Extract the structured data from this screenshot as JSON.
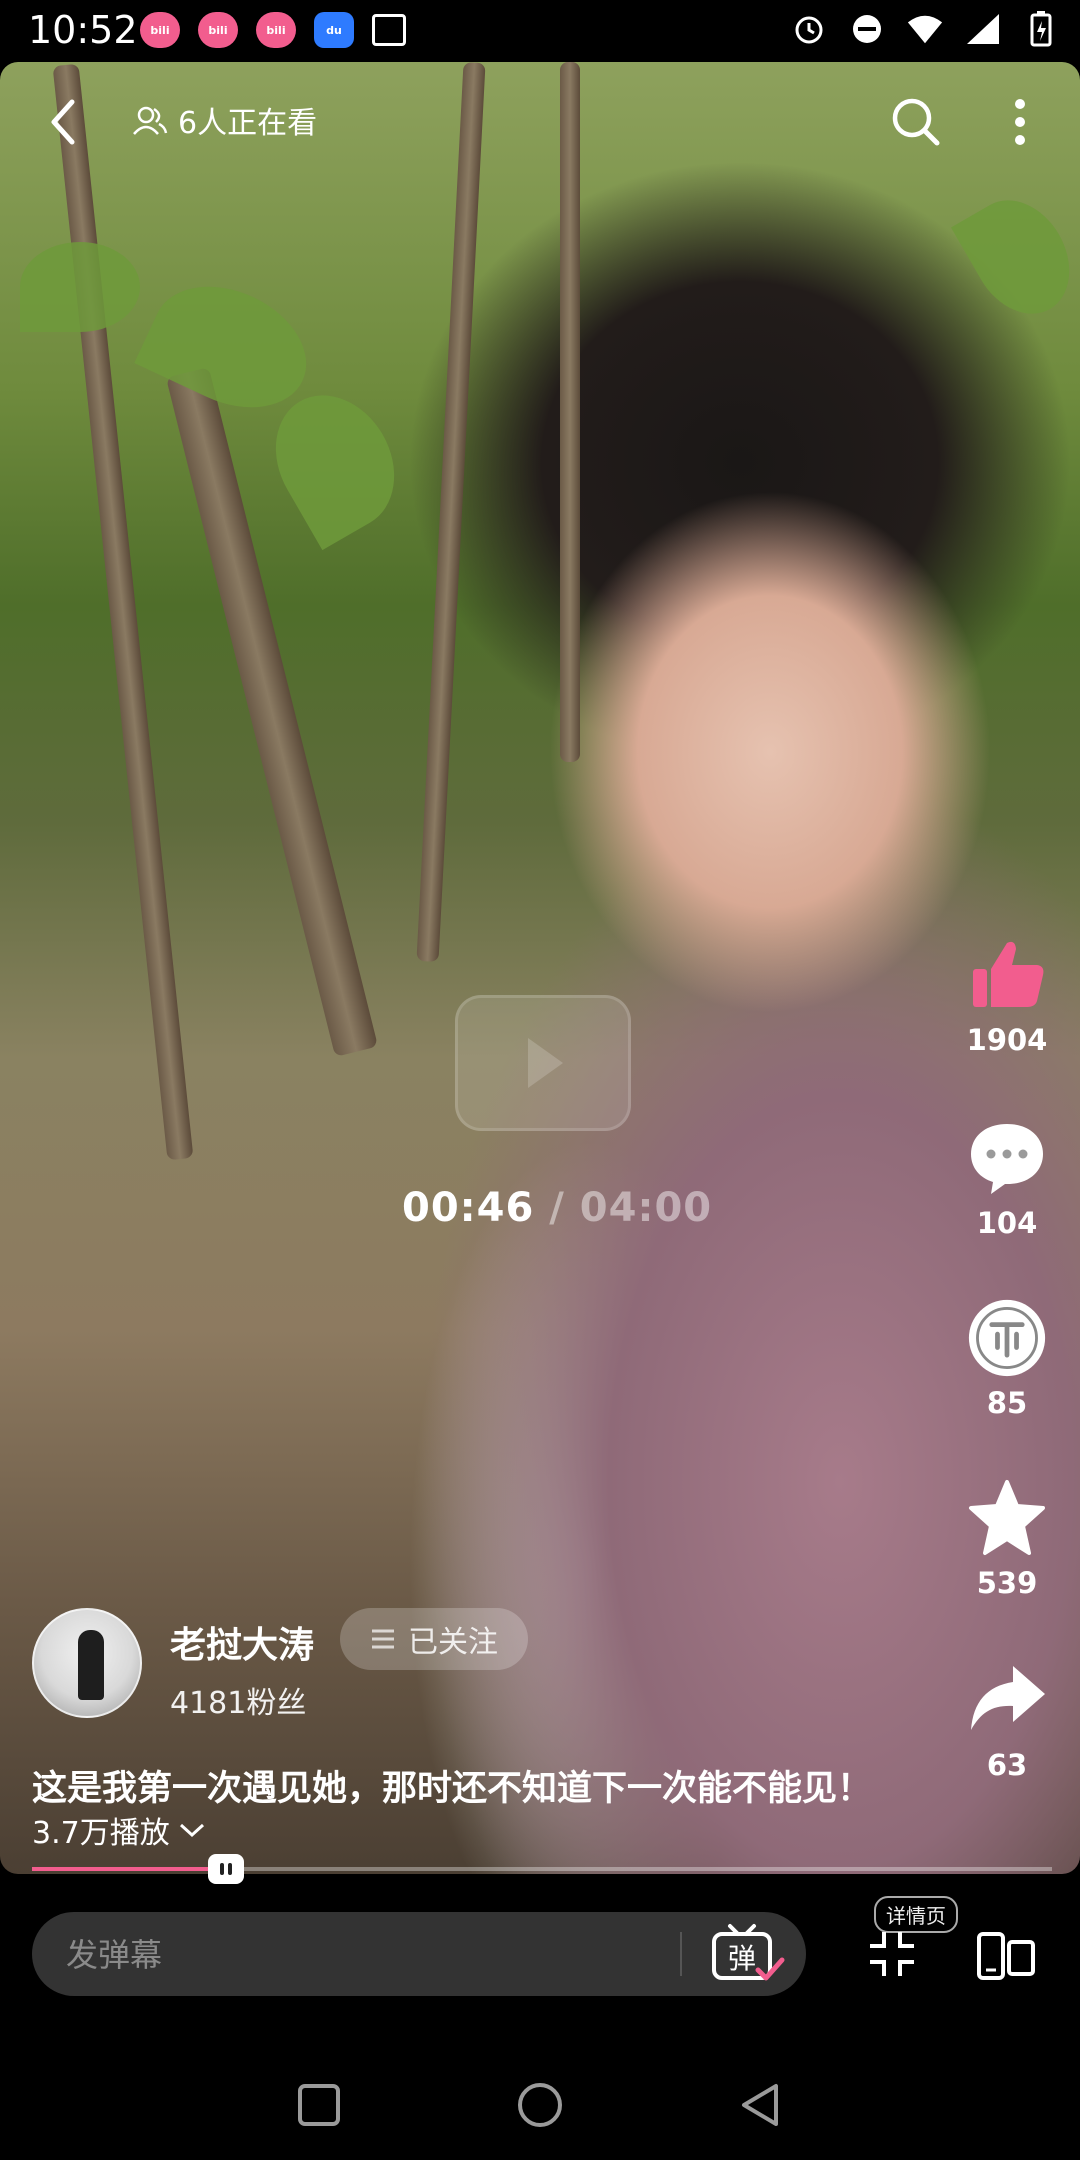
{
  "status_bar": {
    "time": "10:52",
    "notifications": [
      "bilibili",
      "bilibili",
      "bilibili",
      "du",
      "image"
    ]
  },
  "top_bar": {
    "viewers_text": "6人正在看"
  },
  "player": {
    "current_time": "00:46",
    "separator": " / ",
    "total_time": "04:00",
    "progress_fraction": 0.19
  },
  "actions": {
    "like_count": "1904",
    "comment_count": "104",
    "coin_count": "85",
    "favorite_count": "539",
    "share_count": "63"
  },
  "author": {
    "name": "老挝大涛",
    "follow_label": "已关注",
    "fans_text": "4181粉丝"
  },
  "video_info": {
    "caption": "这是我第一次遇见她，那时还不知道下一次能不能见！",
    "plays_text": "3.7万播放"
  },
  "bottom_bar": {
    "danmaku_placeholder": "发弹幕",
    "danmaku_toggle_label": "弹",
    "detail_badge": "详情页"
  },
  "colors": {
    "accent": "#f25d8e",
    "background": "#000000"
  }
}
